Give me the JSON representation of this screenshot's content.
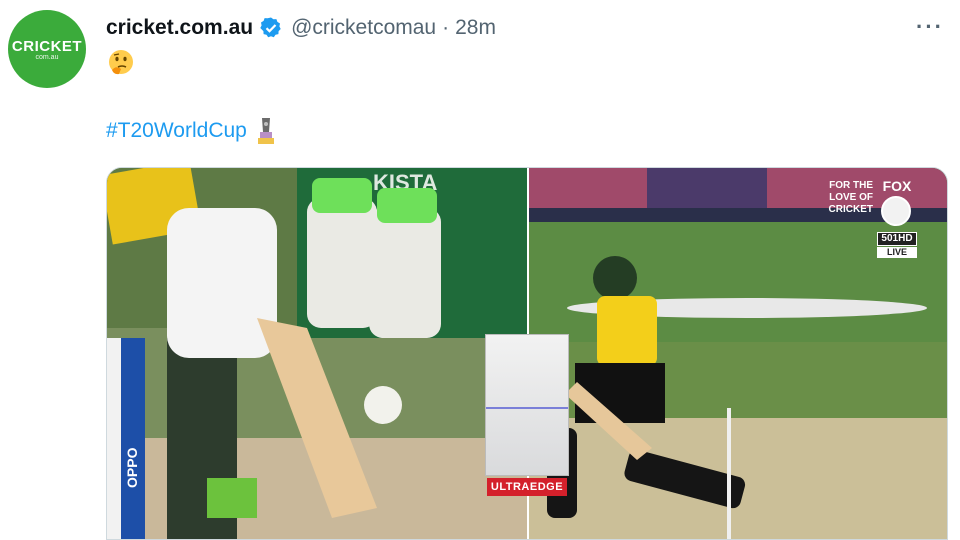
{
  "tweet": {
    "avatar": {
      "logo_text": "CRICKET",
      "logo_sub": "com.au",
      "color": "#3bab3b"
    },
    "display_name": "cricket.com.au",
    "verified_icon": "verified-badge-icon",
    "handle": "@cricketcomau",
    "separator": "·",
    "time": "28m",
    "more_label": "···",
    "emoji": "thinking-face-emoji",
    "hashtag": "#T20WorldCup",
    "hashtag_emoji": "trophy-emoji",
    "link_color": "#1d9bf0"
  },
  "media": {
    "broadcast": {
      "tagline": [
        "FOR THE",
        "LOVE OF",
        "CRICKET"
      ],
      "network": "FOX",
      "channel": "501HD",
      "live_label": "LIVE"
    },
    "ultraedge_label": "ULTRAEDGE",
    "left_panel_jersey_text": "KISTA",
    "stump_text": "OPPO"
  }
}
